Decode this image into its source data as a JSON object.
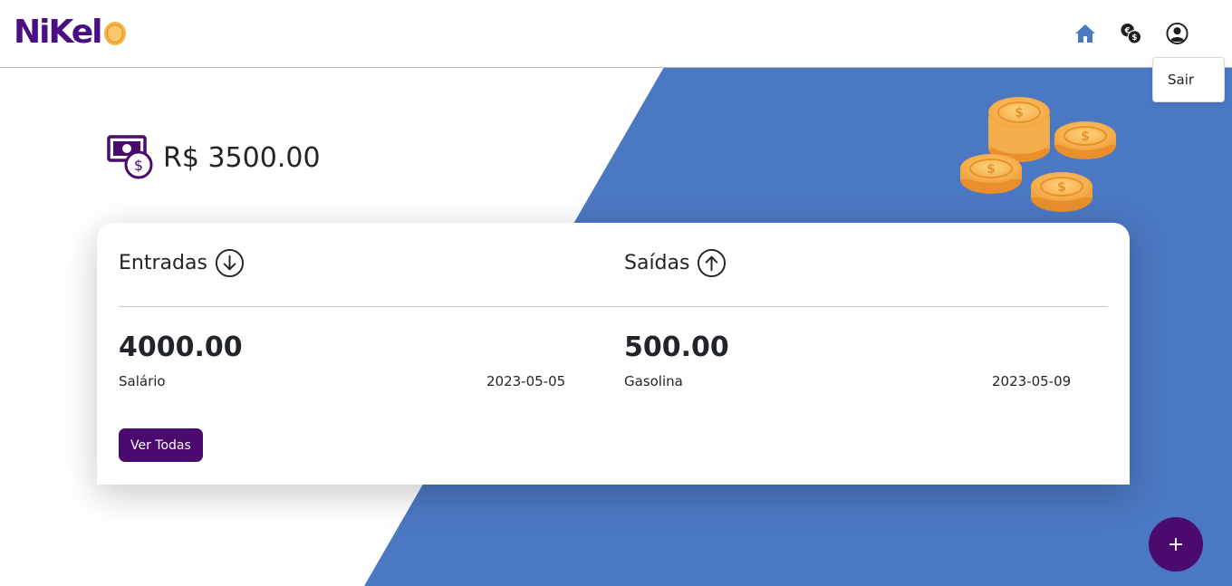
{
  "brand": {
    "name": "NiKel",
    "primary_color": "#4b0a6e",
    "accent_blue": "#4b78c2"
  },
  "nav": {
    "icons": [
      "home-icon",
      "exchange-money-icon",
      "user-circle-icon"
    ],
    "dropdown": {
      "items": [
        {
          "label": "Sair"
        }
      ]
    }
  },
  "balance": {
    "icon": "money-bill-icon",
    "text": "R$ 3500.00"
  },
  "summary": {
    "entradas": {
      "title": "Entradas",
      "icon": "arrow-down-circle-icon",
      "amount": "4000.00",
      "description": "Salário",
      "date": "2023-05-05"
    },
    "saidas": {
      "title": "Saídas",
      "icon": "arrow-up-circle-icon",
      "amount": "500.00",
      "description": "Gasolina",
      "date": "2023-05-09"
    },
    "view_all_label": "Ver Todas"
  },
  "fab": {
    "label": "+",
    "icon": "plus-icon"
  }
}
